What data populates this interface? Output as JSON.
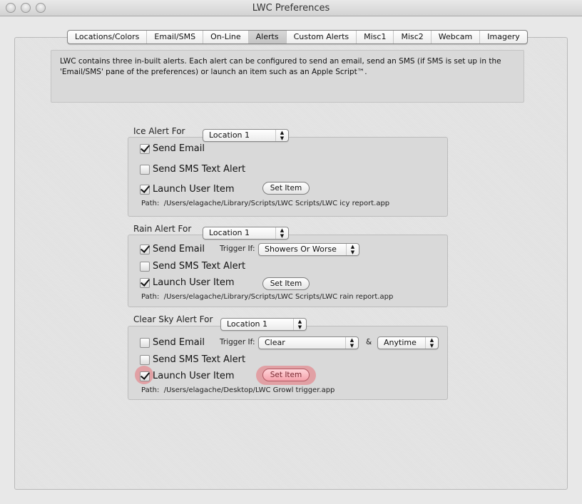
{
  "window": {
    "title": "LWC Preferences",
    "controls": [
      "close-button",
      "minimize-button",
      "zoom-button"
    ]
  },
  "tabs": [
    {
      "label": "Locations/Colors",
      "active": false
    },
    {
      "label": "Email/SMS",
      "active": false
    },
    {
      "label": "On-Line",
      "active": false
    },
    {
      "label": "Alerts",
      "active": true
    },
    {
      "label": "Custom Alerts",
      "active": false
    },
    {
      "label": "Misc1",
      "active": false
    },
    {
      "label": "Misc2",
      "active": false
    },
    {
      "label": "Webcam",
      "active": false
    },
    {
      "label": "Imagery",
      "active": false
    }
  ],
  "info": {
    "text": "LWC contains three in-built alerts. Each alert can be configured to send an email, send an SMS (if SMS is set up in the 'Email/SMS' pane of the preferences) or launch an item such as an Apple Script™."
  },
  "alerts": {
    "ice": {
      "title": "Ice Alert For",
      "location": "Location 1",
      "send_email": {
        "label": "Send Email",
        "checked": true
      },
      "send_sms": {
        "label": "Send SMS Text Alert",
        "checked": false
      },
      "launch_item": {
        "label": "Launch User Item",
        "checked": true
      },
      "set_item_label": "Set Item",
      "path_label": "Path:",
      "path": "/Users/elagache/Library/Scripts/LWC Scripts/LWC icy report.app"
    },
    "rain": {
      "title": "Rain Alert For",
      "location": "Location 1",
      "trigger_label": "Trigger If:",
      "trigger": "Showers Or Worse",
      "send_email": {
        "label": "Send Email",
        "checked": true
      },
      "send_sms": {
        "label": "Send SMS Text Alert",
        "checked": false
      },
      "launch_item": {
        "label": "Launch User Item",
        "checked": true
      },
      "set_item_label": "Set Item",
      "path_label": "Path:",
      "path": "/Users/elagache/Library/Scripts/LWC Scripts/LWC rain report.app"
    },
    "clear": {
      "title": "Clear Sky Alert For",
      "location": "Location 1",
      "trigger_label": "Trigger If:",
      "trigger": "Clear",
      "and_label": "&",
      "time": "Anytime",
      "send_email": {
        "label": "Send Email",
        "checked": false
      },
      "send_sms": {
        "label": "Send SMS Text Alert",
        "checked": false
      },
      "launch_item": {
        "label": "Launch User Item",
        "checked": true
      },
      "set_item_label": "Set Item",
      "path_label": "Path:",
      "path": "/Users/elagache/Desktop/LWC Growl trigger.app"
    }
  },
  "popup_arrows_glyph": "▲▼",
  "highlight_color": "#eb5a64"
}
